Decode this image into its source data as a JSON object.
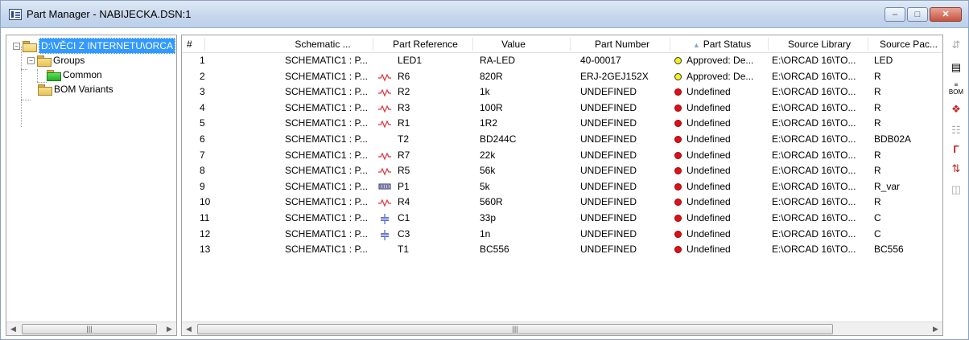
{
  "window": {
    "title": "Part Manager - NABIJECKA.DSN:1"
  },
  "tree": {
    "root": "D:\\VĚCI Z INTERNETU\\ORCA",
    "groups": "Groups",
    "common": "Common",
    "bom_variants": "BOM Variants"
  },
  "columns": [
    "#",
    "Schematic ...",
    "Part Reference",
    "Value",
    "Part Number",
    "Part Status",
    "Source Library",
    "Source Pac..."
  ],
  "rows": [
    {
      "n": "1",
      "sch": "SCHEMATIC1 : P...",
      "icon": "led",
      "ref": "LED1",
      "value": "RA-LED",
      "pn": "40-00017",
      "status": "Approved: De...",
      "status_color": "yellow",
      "lib": "E:\\ORCAD 16\\TO...",
      "pac": "LED"
    },
    {
      "n": "2",
      "sch": "SCHEMATIC1 : P...",
      "icon": "resistor",
      "ref": "R6",
      "value": "820R",
      "pn": "ERJ-2GEJ152X",
      "status": "Approved: De...",
      "status_color": "yellow",
      "lib": "E:\\ORCAD 16\\TO...",
      "pac": "R"
    },
    {
      "n": "3",
      "sch": "SCHEMATIC1 : P...",
      "icon": "resistor",
      "ref": "R2",
      "value": "1k",
      "pn": "UNDEFINED",
      "status": "Undefined",
      "status_color": "red",
      "lib": "E:\\ORCAD 16\\TO...",
      "pac": "R"
    },
    {
      "n": "4",
      "sch": "SCHEMATIC1 : P...",
      "icon": "resistor",
      "ref": "R3",
      "value": "100R",
      "pn": "UNDEFINED",
      "status": "Undefined",
      "status_color": "red",
      "lib": "E:\\ORCAD 16\\TO...",
      "pac": "R"
    },
    {
      "n": "5",
      "sch": "SCHEMATIC1 : P...",
      "icon": "resistor",
      "ref": "R1",
      "value": "1R2",
      "pn": "UNDEFINED",
      "status": "Undefined",
      "status_color": "red",
      "lib": "E:\\ORCAD 16\\TO...",
      "pac": "R"
    },
    {
      "n": "6",
      "sch": "SCHEMATIC1 : P...",
      "icon": "none",
      "ref": "T2",
      "value": "BD244C",
      "pn": "UNDEFINED",
      "status": "Undefined",
      "status_color": "red",
      "lib": "E:\\ORCAD 16\\TO...",
      "pac": "BDB02A"
    },
    {
      "n": "7",
      "sch": "SCHEMATIC1 : P...",
      "icon": "resistor",
      "ref": "R7",
      "value": "22k",
      "pn": "UNDEFINED",
      "status": "Undefined",
      "status_color": "red",
      "lib": "E:\\ORCAD 16\\TO...",
      "pac": "R"
    },
    {
      "n": "8",
      "sch": "SCHEMATIC1 : P...",
      "icon": "resistor",
      "ref": "R5",
      "value": "56k",
      "pn": "UNDEFINED",
      "status": "Undefined",
      "status_color": "red",
      "lib": "E:\\ORCAD 16\\TO...",
      "pac": "R"
    },
    {
      "n": "9",
      "sch": "SCHEMATIC1 : P...",
      "icon": "potentiometer",
      "ref": "P1",
      "value": "5k",
      "pn": "UNDEFINED",
      "status": "Undefined",
      "status_color": "red",
      "lib": "E:\\ORCAD 16\\TO...",
      "pac": "R_var"
    },
    {
      "n": "10",
      "sch": "SCHEMATIC1 : P...",
      "icon": "resistor",
      "ref": "R4",
      "value": "560R",
      "pn": "UNDEFINED",
      "status": "Undefined",
      "status_color": "red",
      "lib": "E:\\ORCAD 16\\TO...",
      "pac": "R"
    },
    {
      "n": "11",
      "sch": "SCHEMATIC1 : P...",
      "icon": "capacitor",
      "ref": "C1",
      "value": "33p",
      "pn": "UNDEFINED",
      "status": "Undefined",
      "status_color": "red",
      "lib": "E:\\ORCAD 16\\TO...",
      "pac": "C"
    },
    {
      "n": "12",
      "sch": "SCHEMATIC1 : P...",
      "icon": "capacitor",
      "ref": "C3",
      "value": "1n",
      "pn": "UNDEFINED",
      "status": "Undefined",
      "status_color": "red",
      "lib": "E:\\ORCAD 16\\TO...",
      "pac": "C"
    },
    {
      "n": "13",
      "sch": "SCHEMATIC1 : P...",
      "icon": "none",
      "ref": "T1",
      "value": "BC556",
      "pn": "UNDEFINED",
      "status": "Undefined",
      "status_color": "red",
      "lib": "E:\\ORCAD 16\\TO...",
      "pac": "BC556"
    }
  ],
  "sort": {
    "column": "Part Status",
    "direction": "ascending"
  },
  "colors": {
    "selection": "#3399ff",
    "status_red": "#e0101a",
    "status_yellow": "#f5f21a",
    "part_icon": "#e0303a",
    "cap_icon": "#2040c0"
  },
  "toolbar_icons": [
    "sync-icon",
    "properties-icon",
    "bom-icon",
    "assign-icon",
    "compare-icon",
    "link-icon",
    "update-icon",
    "help-icon"
  ]
}
